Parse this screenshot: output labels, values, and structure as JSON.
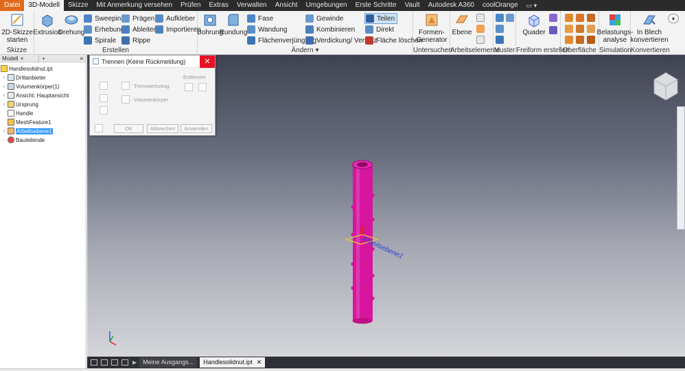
{
  "menu_tabs": [
    "Datei",
    "3D-Modell",
    "Skizze",
    "Mit Anmerkung versehen",
    "Prüfen",
    "Extras",
    "Verwalten",
    "Ansicht",
    "Umgebungen",
    "Erste Schritte",
    "Vault",
    "Autodesk A360",
    "coolOrange"
  ],
  "ribbon": {
    "skizze": {
      "title": "Skizze",
      "start_label": "2D-Skizze starten"
    },
    "erstellen": {
      "title": "Erstellen",
      "extrusion": "Extrusion",
      "drehung": "Drehung",
      "sweeping": "Sweeping",
      "erhebung": "Erhebung",
      "spirale": "Spirale",
      "praegen": "Prägen",
      "ableiten": "Ableiten",
      "rippe": "Rippe",
      "aufkleber": "Aufkleber",
      "importieren": "Importieren"
    },
    "aendern": {
      "title": "Ändern",
      "bohrung": "Bohrung",
      "rundung": "Rundung",
      "fase": "Fase",
      "wandung": "Wandung",
      "flaechenverjuengung": "Flächenverjüngung",
      "gewinde": "Gewinde",
      "kombinieren": "Kombinieren",
      "verdickung": "Verdickung/ Versatz",
      "teilen": "Teilen",
      "direkt": "Direkt",
      "flaeche_loeschen": "Fläche löschen"
    },
    "untersuchen": {
      "title": "Untersuchen",
      "formen_generator": "Formen-Generator"
    },
    "arbeitselemente": {
      "title": "Arbeitselemente",
      "ebene": "Ebene"
    },
    "muster": {
      "title": "Muster"
    },
    "freiform": {
      "title": "Freiform erstellen",
      "quader": "Quader"
    },
    "oberflaeche": {
      "title": "Oberfläche"
    },
    "simulation": {
      "title": "Simulation",
      "belastungsanalyse": "Belastungs-analyse"
    },
    "konvertieren": {
      "title": "Konvertieren",
      "in_blech": "In Blech konvertieren"
    }
  },
  "browser": {
    "tab_label": "Modell",
    "items": [
      {
        "label": "Handlesolidnut.ipt"
      },
      {
        "label": "Drittanbieter"
      },
      {
        "label": "Volumenkörper(1)"
      },
      {
        "label": "Ansicht: Hauptansicht"
      },
      {
        "label": "Ursprung"
      },
      {
        "label": "Handle"
      },
      {
        "label": "MeshFeature1"
      },
      {
        "label": "Arbeitsebene1"
      },
      {
        "label": "Bauteilende"
      }
    ]
  },
  "dialog": {
    "title": "Trennen (Keine Rückmeldung)",
    "entfernen": "Entfernen",
    "trennwerkzeug": "Trennwerkzeug",
    "volumenkoerper": "Volumenkörper",
    "ok": "OK",
    "abbrechen": "Abbrechen",
    "anwenden": "Anwenden"
  },
  "viewport": {
    "plane_label": "Arbeitsebene1"
  },
  "doc_tabs": [
    {
      "label": "Meine Ausgangs...",
      "active": false
    },
    {
      "label": "Handlesolidnut.ipt",
      "active": true
    }
  ],
  "colors": {
    "file_tab": "#e06a1b",
    "model_magenta": "#d6169e",
    "selection": "#3399ff"
  }
}
